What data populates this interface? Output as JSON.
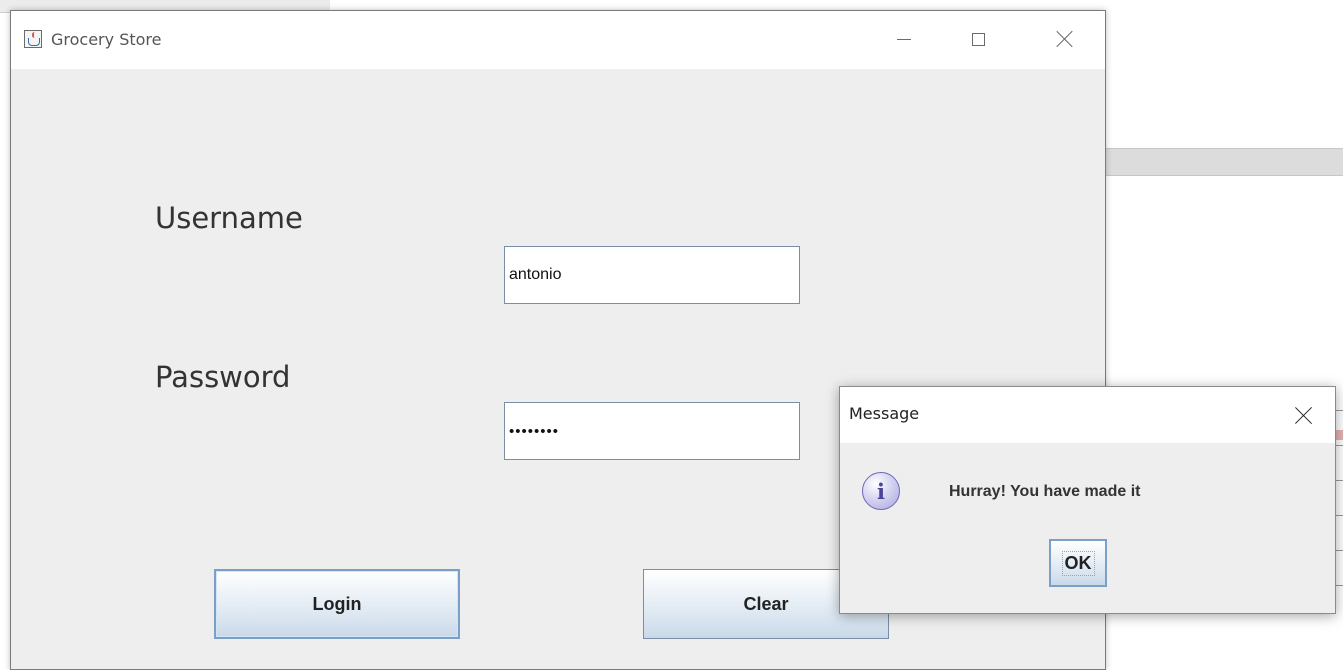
{
  "main_window": {
    "title": "Grocery Store",
    "icon": "java-icon",
    "controls": [
      "minimize-icon",
      "maximize-icon",
      "close-icon"
    ]
  },
  "login_form": {
    "username_label": "Username",
    "username_value": "antonio",
    "password_label": "Password",
    "password_value": "••••••••",
    "login_label": "Login",
    "clear_label": "Clear"
  },
  "dialog": {
    "title": "Message",
    "icon": "info-icon",
    "icon_glyph": "i",
    "message": "Hurray! You have made it",
    "ok_label": "OK"
  },
  "colors": {
    "button_border": "#7ba0c8",
    "panel_bg": "#eeeeee",
    "info_icon": "#6f6ab6"
  }
}
